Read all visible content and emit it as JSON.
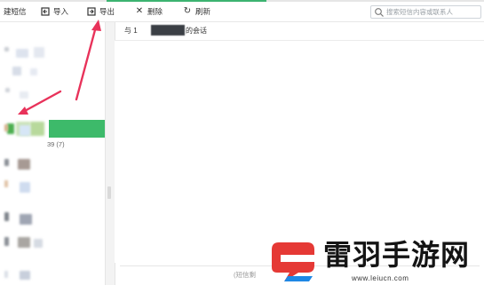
{
  "toolbar": {
    "items": [
      {
        "label": "建短信"
      },
      {
        "label": "导入"
      },
      {
        "label": "导出"
      },
      {
        "label": "删除"
      },
      {
        "label": "刷新"
      }
    ]
  },
  "search": {
    "placeholder": "搜索短信内容或联系人"
  },
  "sidebar": {
    "count_label": "39 (7)"
  },
  "conversation": {
    "header_prefix": "与 1",
    "header_suffix": "的会话"
  },
  "compose": {
    "placeholder": "(短信剩"
  },
  "watermark": {
    "brand": "雷羽手游网",
    "url": "www.leiucn.com"
  },
  "colors": {
    "accent_green": "#3dba6a",
    "arrow": "#e8325a",
    "logo_red": "#e53935",
    "logo_blue": "#1e88e5"
  }
}
